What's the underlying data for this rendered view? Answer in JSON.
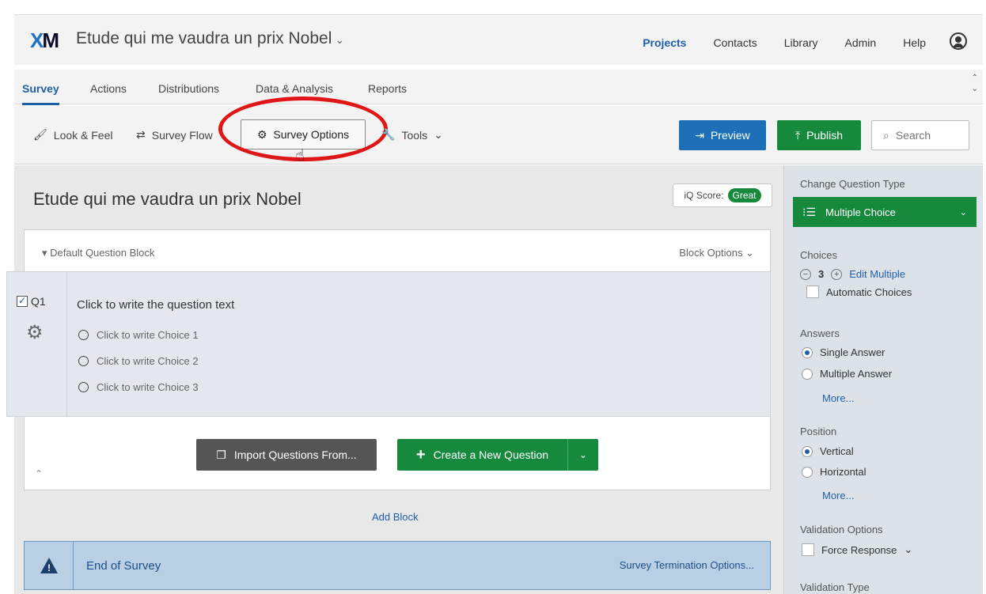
{
  "topbar": {
    "logo": {
      "x": "X",
      "m": "M"
    },
    "project_title": "Etude qui me vaudra un prix Nobel",
    "nav": [
      "Projects",
      "Contacts",
      "Library",
      "Admin",
      "Help"
    ],
    "active_nav": "Projects"
  },
  "tabs": [
    "Survey",
    "Actions",
    "Distributions",
    "Data & Analysis",
    "Reports"
  ],
  "toolbar": {
    "look_feel": "Look & Feel",
    "survey_flow": "Survey Flow",
    "survey_options": "Survey Options",
    "tools": "Tools",
    "preview": "Preview",
    "publish": "Publish",
    "search_placeholder": "Search"
  },
  "editor": {
    "survey_title": "Etude qui me vaudra un prix Nobel",
    "iq_score_label": "iQ Score:",
    "iq_score_value": "Great",
    "block_name": "Default Question Block",
    "block_options": "Block Options",
    "question": {
      "number": "Q1",
      "text": "Click to write the question text",
      "choices": [
        "Click to write Choice 1",
        "Click to write Choice 2",
        "Click to write Choice 3"
      ]
    },
    "import_button": "Import Questions From...",
    "create_button": "Create a New Question",
    "add_block": "Add Block",
    "end_of_survey": "End of Survey",
    "termination_options": "Survey Termination Options..."
  },
  "sidebar": {
    "change_type_label": "Change Question Type",
    "question_type": "Multiple Choice",
    "choices_label": "Choices",
    "choices_count": "3",
    "edit_multiple": "Edit Multiple",
    "automatic_choices": "Automatic Choices",
    "answers_label": "Answers",
    "single_answer": "Single Answer",
    "multiple_answer": "Multiple Answer",
    "more": "More...",
    "position_label": "Position",
    "vertical": "Vertical",
    "horizontal": "Horizontal",
    "validation_options_label": "Validation Options",
    "force_response": "Force Response",
    "validation_type_label": "Validation Type"
  },
  "colors": {
    "accent_blue": "#1f5fa8",
    "publish_green": "#17893d",
    "highlight_red": "#e01515"
  }
}
